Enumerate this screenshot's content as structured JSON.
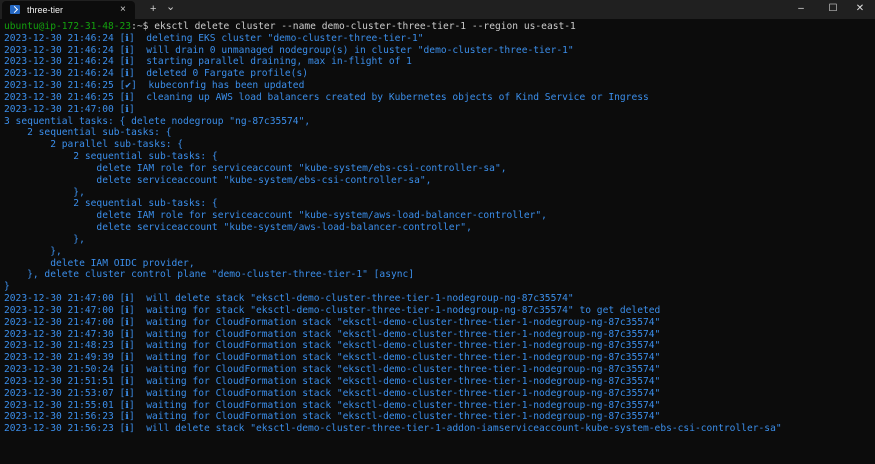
{
  "tab": {
    "title": "three-tier",
    "close": "×"
  },
  "titlebar": {
    "new_tab": "+",
    "dropdown": "⌄",
    "minimize": "–",
    "maximize": "☐",
    "close": "✕"
  },
  "prompt": {
    "user_host": "ubuntu@ip-172-31-48-23",
    "path_sym": ":~$ ",
    "command": "eksctl delete cluster --name demo-cluster-three-tier-1 --region us-east-1"
  },
  "log_lines": [
    "2023-12-30 21:46:24 [ℹ]  deleting EKS cluster \"demo-cluster-three-tier-1\"",
    "2023-12-30 21:46:24 [ℹ]  will drain 0 unmanaged nodegroup(s) in cluster \"demo-cluster-three-tier-1\"",
    "2023-12-30 21:46:24 [ℹ]  starting parallel draining, max in-flight of 1",
    "2023-12-30 21:46:24 [ℹ]  deleted 0 Fargate profile(s)",
    "2023-12-30 21:46:25 [✔]  kubeconfig has been updated",
    "2023-12-30 21:46:25 [ℹ]  cleaning up AWS load balancers created by Kubernetes objects of Kind Service or Ingress",
    "2023-12-30 21:47:00 [ℹ]  "
  ],
  "task_tree": [
    "3 sequential tasks: { delete nodegroup \"ng-87c35574\",",
    "    2 sequential sub-tasks: {",
    "        2 parallel sub-tasks: {",
    "            2 sequential sub-tasks: {",
    "                delete IAM role for serviceaccount \"kube-system/ebs-csi-controller-sa\",",
    "                delete serviceaccount \"kube-system/ebs-csi-controller-sa\",",
    "            },",
    "            2 sequential sub-tasks: {",
    "                delete IAM role for serviceaccount \"kube-system/aws-load-balancer-controller\",",
    "                delete serviceaccount \"kube-system/aws-load-balancer-controller\",",
    "            },",
    "        },",
    "        delete IAM OIDC provider,",
    "    }, delete cluster control plane \"demo-cluster-three-tier-1\" [async]",
    "}"
  ],
  "stack_lines": [
    "2023-12-30 21:47:00 [ℹ]  will delete stack \"eksctl-demo-cluster-three-tier-1-nodegroup-ng-87c35574\"",
    "2023-12-30 21:47:00 [ℹ]  waiting for stack \"eksctl-demo-cluster-three-tier-1-nodegroup-ng-87c35574\" to get deleted",
    "2023-12-30 21:47:00 [ℹ]  waiting for CloudFormation stack \"eksctl-demo-cluster-three-tier-1-nodegroup-ng-87c35574\"",
    "2023-12-30 21:47:30 [ℹ]  waiting for CloudFormation stack \"eksctl-demo-cluster-three-tier-1-nodegroup-ng-87c35574\"",
    "2023-12-30 21:48:23 [ℹ]  waiting for CloudFormation stack \"eksctl-demo-cluster-three-tier-1-nodegroup-ng-87c35574\"",
    "2023-12-30 21:49:39 [ℹ]  waiting for CloudFormation stack \"eksctl-demo-cluster-three-tier-1-nodegroup-ng-87c35574\"",
    "2023-12-30 21:50:24 [ℹ]  waiting for CloudFormation stack \"eksctl-demo-cluster-three-tier-1-nodegroup-ng-87c35574\"",
    "2023-12-30 21:51:51 [ℹ]  waiting for CloudFormation stack \"eksctl-demo-cluster-three-tier-1-nodegroup-ng-87c35574\"",
    "2023-12-30 21:53:07 [ℹ]  waiting for CloudFormation stack \"eksctl-demo-cluster-three-tier-1-nodegroup-ng-87c35574\"",
    "2023-12-30 21:55:01 [ℹ]  waiting for CloudFormation stack \"eksctl-demo-cluster-three-tier-1-nodegroup-ng-87c35574\"",
    "2023-12-30 21:56:23 [ℹ]  waiting for CloudFormation stack \"eksctl-demo-cluster-three-tier-1-nodegroup-ng-87c35574\"",
    "2023-12-30 21:56:23 [ℹ]  will delete stack \"eksctl-demo-cluster-three-tier-1-addon-iamserviceaccount-kube-system-ebs-csi-controller-sa\""
  ],
  "colors": {
    "background": "#0c0c0c",
    "text_blue": "#3b8eea",
    "prompt_green": "#13a10e",
    "titlebar": "#202020"
  },
  "icons": {
    "tab_icon": "powershell-terminal-icon"
  }
}
